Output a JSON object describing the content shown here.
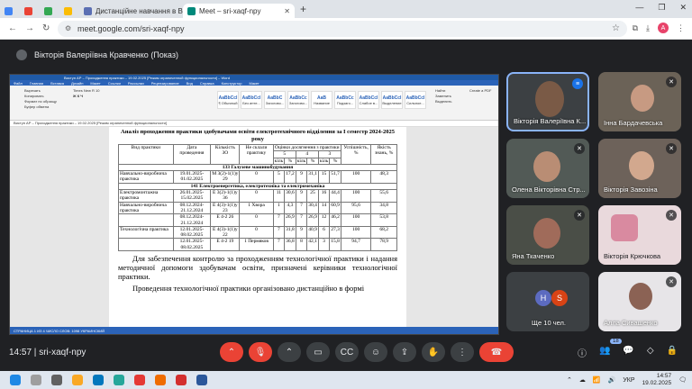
{
  "browser": {
    "tabs": [
      {
        "label": "",
        "color": "#4285f4"
      },
      {
        "label": "",
        "color": "#ea4335"
      },
      {
        "label": "",
        "color": "#34a853"
      },
      {
        "label": "",
        "color": "#fbbc04"
      },
      {
        "label": "Дистанційне навчання в ВСП",
        "color": "#5b6fb3"
      },
      {
        "label": "Meet – sri-xaqf-npy",
        "color": "#00897b"
      }
    ],
    "url": "meet.google.com/sri-xaqf-npy",
    "profile_initial": "A",
    "colors": {
      "accent": "#1a73e8",
      "profile": "#e8436a"
    }
  },
  "meet": {
    "presenter_label": "Вікторія Валеріївна Кравченко (Показ)",
    "time": "14:57",
    "meeting_code": "sri-xaqf-npy",
    "participants_count": "18",
    "tiles": [
      {
        "name": "Вікторія Валеріївна К...",
        "speaking": true
      },
      {
        "name": "Інна Бардачевська",
        "speaking": false
      },
      {
        "name": "Олена Вікторівна Стр...",
        "speaking": false
      },
      {
        "name": "Вікторія Завозіна",
        "speaking": false
      },
      {
        "name": "Яна Ткаченко",
        "speaking": false
      },
      {
        "name": "Вікторія Крючкова",
        "speaking": false
      },
      {
        "name": "Ще 10 чел.",
        "speaking": false
      },
      {
        "name": "Алла Сивашенко",
        "speaking": false
      }
    ],
    "more_initials": [
      "H",
      "S"
    ]
  },
  "word": {
    "title_bar": "Виступ АР – Проходження практики – 19.02.2025 [Режим ограниченной функциональности] – Word",
    "ribbon_tabs": [
      "Файл",
      "Главная",
      "Вставка",
      "Дизайн",
      "Макет",
      "Ссылки",
      "Рассылки",
      "Рецензирование",
      "Вид",
      "Справка",
      "Конструктор",
      "Макет"
    ],
    "ribbon_groups": {
      "clipboard": [
        "Вырезать",
        "Копировать",
        "Формат по образцу",
        "Буфер обмена"
      ],
      "font": "Times New R  10",
      "styles": [
        {
          "preview": "AaBbCcI",
          "name": "¶ Обычный"
        },
        {
          "preview": "AaBbCcI",
          "name": "Без инте..."
        },
        {
          "preview": "AaBbC",
          "name": "Заголово..."
        },
        {
          "preview": "AaBbCc",
          "name": "Заголово..."
        },
        {
          "preview": "AaB",
          "name": "Название"
        },
        {
          "preview": "AaBbCc",
          "name": "Подзаго..."
        },
        {
          "preview": "AaBbCcI",
          "name": "Слабое в..."
        },
        {
          "preview": "AaBbCcI",
          "name": "Выделение"
        },
        {
          "preview": "AaBbCcI",
          "name": "Сильное..."
        }
      ],
      "editing": [
        "Найти",
        "Заменить",
        "Выделить"
      ],
      "pdf": "Create a PDF"
    },
    "doc_info": "Виступ АР – Проходження практики – 19.02.2025 [Режим ограниченной функциональности]",
    "status_bar": "СТРАНИЦА 1 ИЗ 4    ЧИСЛО СЛОВ: 1098    УКРАИНСКИЙ",
    "doc": {
      "title": "Аналіз проходження практики здобувачами освіти електротехнічного відділення за І семестр 2024-2025 року",
      "headers": [
        "Вид практики",
        "Дата проведення",
        "Кількість ЗО",
        "Не склали практику",
        "Оцінки досягнення з практики",
        "Успішність, %",
        "Якість знань, %"
      ],
      "grade_heads": [
        "5",
        "4",
        "3"
      ],
      "sub_heads": [
        "кіль",
        "%",
        "кіль",
        "%",
        "кіль",
        "%"
      ],
      "sections": [
        {
          "title": "133 Галузеве машинобудування",
          "rows": [
            [
              "Навчально-виробнича практика",
              "19.01.2025-01.02.2025",
              "М 3(2)-1(1)у 29",
              "0",
              "5",
              "17,2",
              "9",
              "31,1",
              "15",
              "51,7",
              "100",
              "48,3"
            ]
          ]
        },
        {
          "title": "141 Електроенергетика, електротехніка та електромеханіка",
          "rows": [
            [
              "Електромонтажна практика",
              "26.01.2025-15.02.2025",
              "Е 3(2)-1(1)у 36",
              "0",
              "11",
              "30,6",
              "9",
              "25",
              "16",
              "44,4",
              "100",
              "55,6"
            ],
            [
              "Навчально-виробнича практика",
              "08.12.2024-21.12.2024",
              "Е 4(3)-1(1)у 23",
              "1 Хвора",
              "1",
              "4,3",
              "7",
              "30,4",
              "14",
              "60,9",
              "95,6",
              "34,8"
            ],
            [
              "",
              "08.12.2024-21.12.2024",
              "Е 4-2 26",
              "0",
              "7",
              "26,9",
              "7",
              "26,9",
              "12",
              "46,2",
              "100",
              "53,8"
            ],
            [
              "Технологічна практика",
              "12.01.2025-08.02.2025",
              "Е 4(3)-1(1)у 22",
              "0",
              "7",
              "31,8",
              "9",
              "40,9",
              "6",
              "27,3",
              "100",
              "68,2"
            ],
            [
              "",
              "12.01.2025-08.02.2025",
              "Е 4-2 19",
              "1 Пермяков",
              "7",
              "36,8",
              "8",
              "42,1",
              "3",
              "15,8",
              "94,7",
              "78,9"
            ]
          ]
        }
      ],
      "paragraph1": "Для забезпечення контролю за проходженням технологічної практики і надання методичної допомоги здобувачам освіти, призначені керівники технологічної практики.",
      "paragraph2": "Проведення технологічної практики організовано дистанційно в формі"
    }
  },
  "taskbar": {
    "lang": "УКР",
    "clock_time": "14:57",
    "clock_date": "19.02.2025"
  }
}
